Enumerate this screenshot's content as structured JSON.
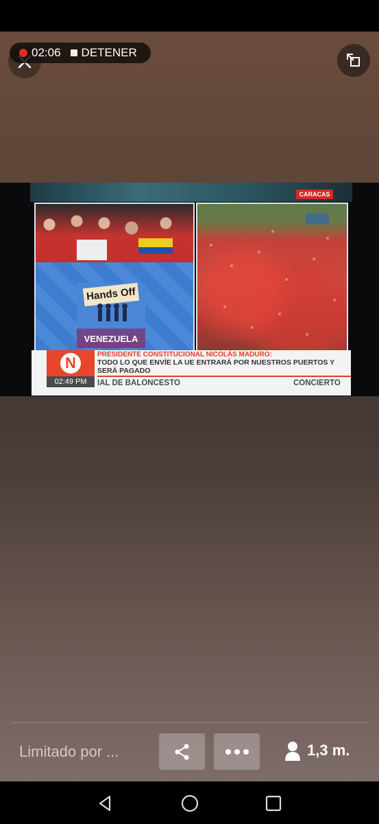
{
  "recording": {
    "time": "02:06",
    "stop_label": "DETENER"
  },
  "video": {
    "location_tag": "CARACAS",
    "sign_text": "Hands Off",
    "podium_text": "VENEZUELA",
    "channel_logo": "N",
    "clock": "02:49 PM",
    "headline_title": "PRESIDENTE CONSTITUCIONAL NICOLÁS MADURO:",
    "headline_body": "TODO LO QUE ENVÍE LA UE ENTRARÁ POR NUESTROS PUERTOS Y SERÁ PAGADO",
    "ticker_left": "IAL DE BALONCESTO",
    "ticker_right": "CONCIERTO"
  },
  "footer": {
    "limited_text": "Limitado por ...",
    "share_icon": "share-icon",
    "more_icon": "more-icon",
    "viewer_count": "1,3 m."
  },
  "colors": {
    "accent_red": "#e53c2a",
    "record_red": "#e12b2b"
  }
}
